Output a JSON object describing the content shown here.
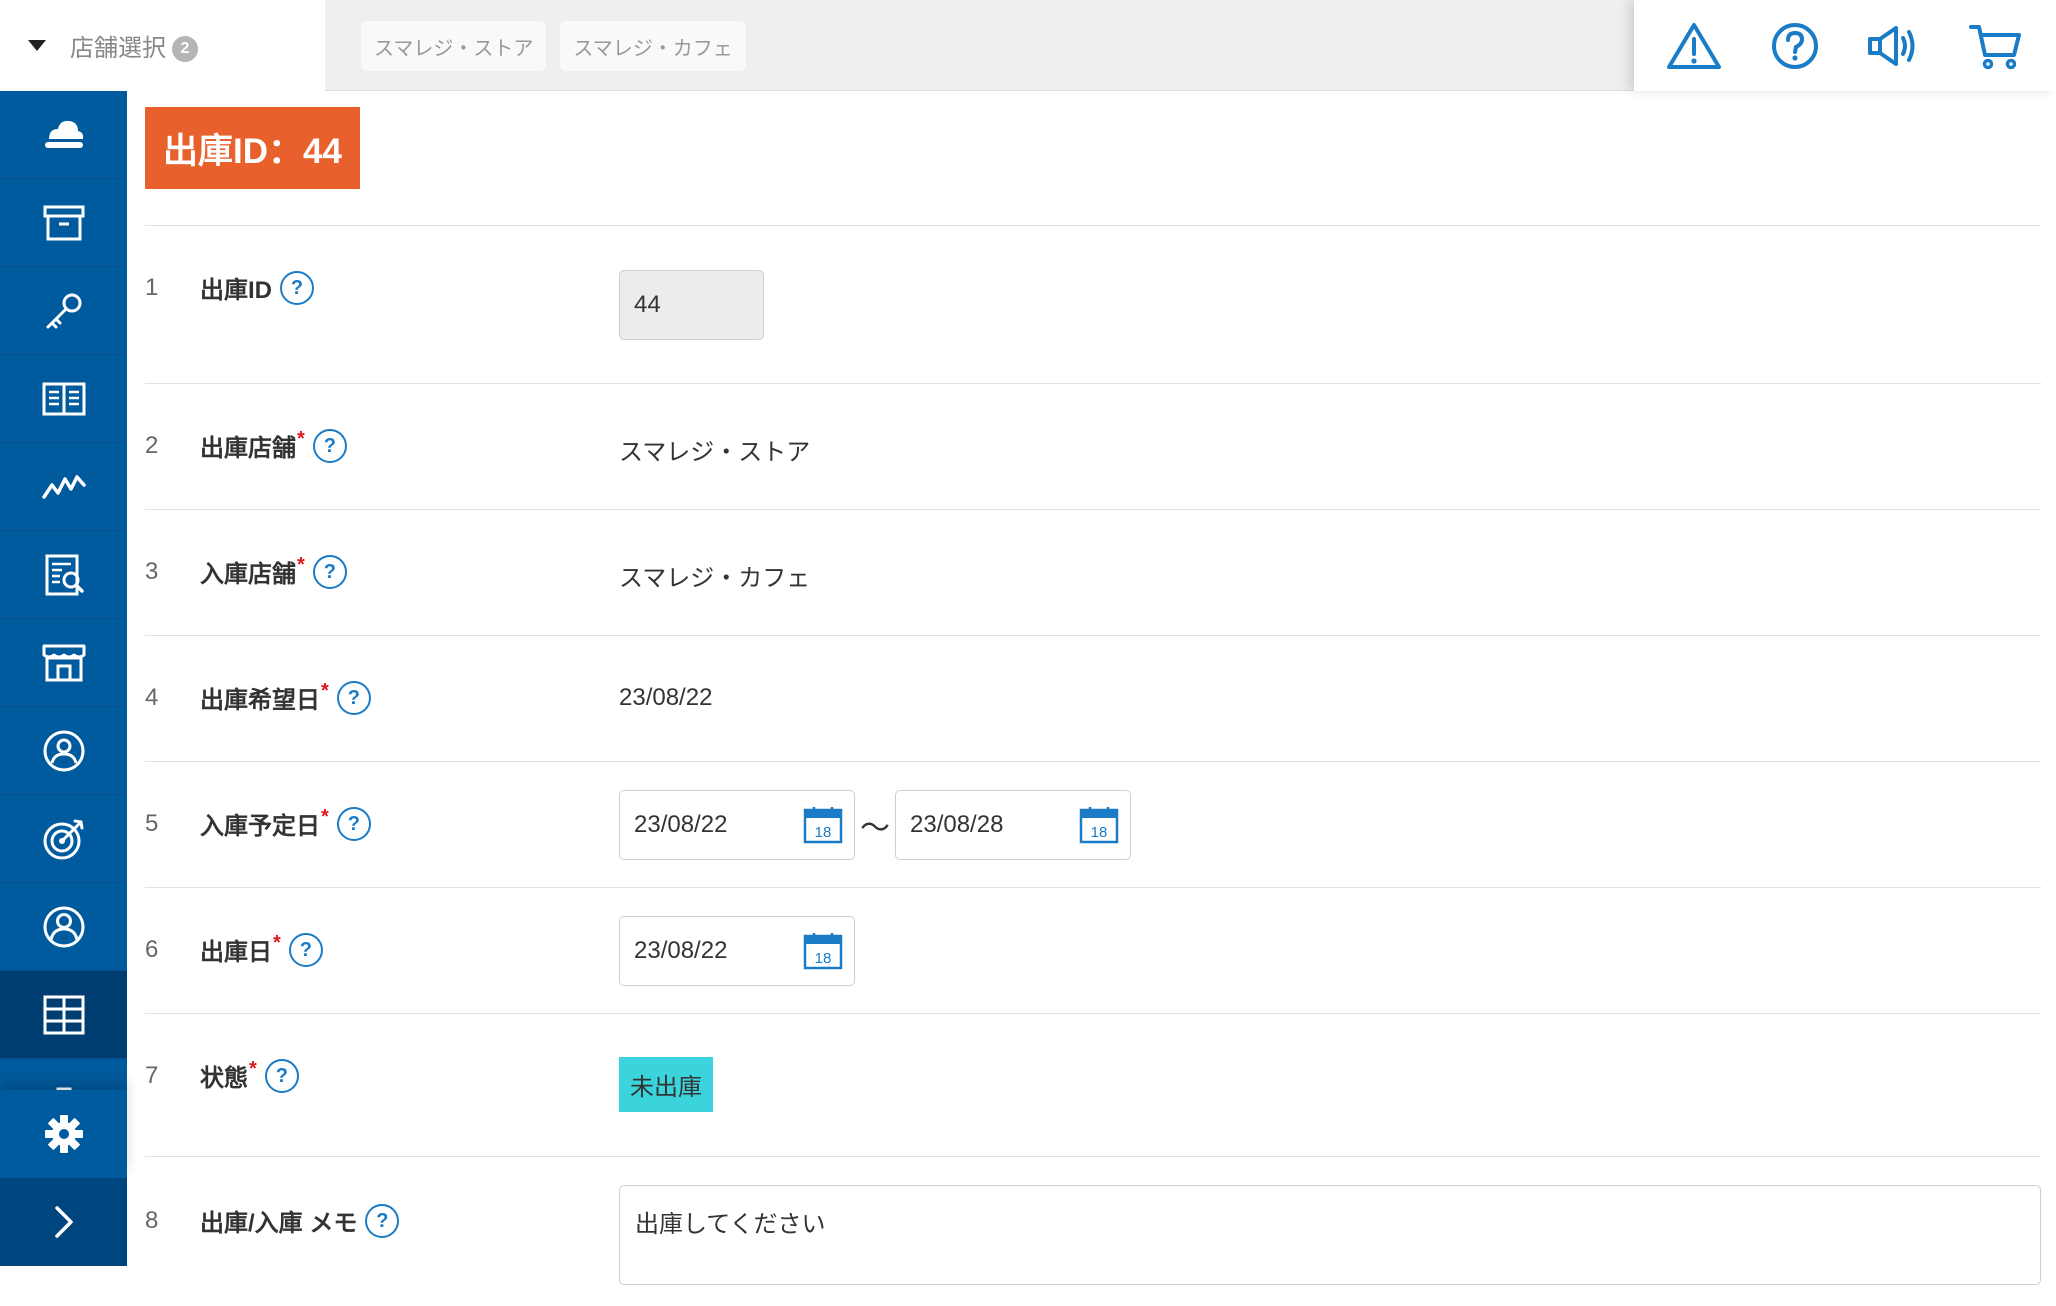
{
  "header": {
    "store_select_label": "店舗選択",
    "store_select_count": "2",
    "selected_stores": [
      "スマレジ・ストア",
      "スマレジ・カフェ"
    ],
    "actions": [
      "warning-icon",
      "help-icon",
      "announcement-icon",
      "cart-icon"
    ]
  },
  "sidebar": {
    "items": [
      "cloud-icon",
      "archive-icon",
      "key-icon",
      "book-icon",
      "chart-icon",
      "report-icon",
      "store-icon",
      "customer-icon",
      "target-icon",
      "staff-icon",
      "inventory-icon",
      "clipboard-icon"
    ],
    "active_item": "inventory-icon",
    "bottom": [
      "gear-icon",
      "chevron-right-icon"
    ]
  },
  "page": {
    "title": "出庫ID：44"
  },
  "form": {
    "row1": {
      "num": "1",
      "label": "出庫ID",
      "value": "44"
    },
    "row2": {
      "num": "2",
      "label": "出庫店舗",
      "required": "*",
      "value": "スマレジ・ストア"
    },
    "row3": {
      "num": "3",
      "label": "入庫店舗",
      "required": "*",
      "value": "スマレジ・カフェ"
    },
    "row4": {
      "num": "4",
      "label": "出庫希望日",
      "required": "*",
      "value": "23/08/22"
    },
    "row5": {
      "num": "5",
      "label": "入庫予定日",
      "required": "*",
      "from": "23/08/22",
      "separator": "〜",
      "to": "23/08/28"
    },
    "row6": {
      "num": "6",
      "label": "出庫日",
      "required": "*",
      "value": "23/08/22"
    },
    "row7": {
      "num": "7",
      "label": "状態",
      "required": "*",
      "status": "未出庫"
    },
    "row8": {
      "num": "8",
      "label": "出庫/入庫 メモ",
      "memo": "出庫してください"
    }
  },
  "help_mark": "?",
  "calendar_day": "18",
  "colors": {
    "sidebar": "#005a9e",
    "title_badge": "#e8612c",
    "status_badge": "#3cd4dc",
    "required": "#e0171d",
    "help": "#1a7bc6"
  }
}
